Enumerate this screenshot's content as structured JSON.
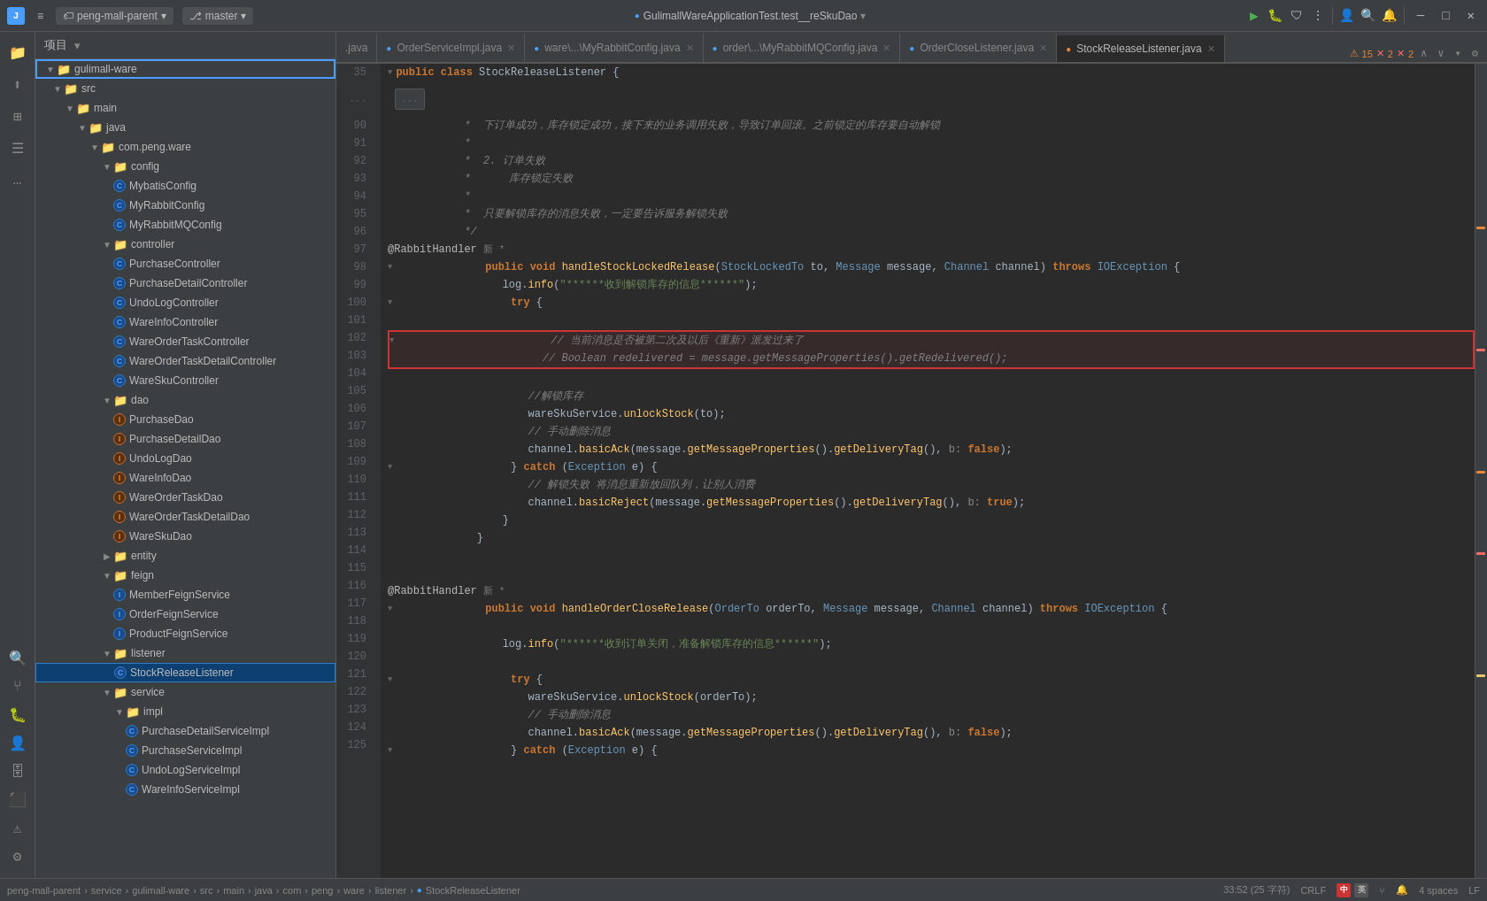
{
  "titlebar": {
    "logo": "J",
    "menu_items": [
      "peng-mall-parent",
      "master"
    ],
    "center_text": "GulimallWareApplicationTest.test__reSkuDao",
    "run_label": "▶",
    "settings_label": "⚙",
    "profile_label": "👤",
    "search_label": "🔍",
    "notifications_label": "🔔",
    "minimize": "─",
    "maximize": "□",
    "close": "✕"
  },
  "sidebar": {
    "header": "项目",
    "root": "gulimall-ware",
    "tree": [
      {
        "id": "src",
        "label": "src",
        "indent": 1,
        "type": "folder",
        "expanded": true
      },
      {
        "id": "main",
        "label": "main",
        "indent": 2,
        "type": "folder",
        "expanded": true
      },
      {
        "id": "java",
        "label": "java",
        "indent": 3,
        "type": "folder",
        "expanded": true
      },
      {
        "id": "com.peng.ware",
        "label": "com.peng.ware",
        "indent": 4,
        "type": "folder",
        "expanded": true
      },
      {
        "id": "config",
        "label": "config",
        "indent": 5,
        "type": "folder",
        "expanded": true
      },
      {
        "id": "MybatisConfig",
        "label": "MybatisConfig",
        "indent": 6,
        "type": "java-blue"
      },
      {
        "id": "MyRabbitConfig",
        "label": "MyRabbitConfig",
        "indent": 6,
        "type": "java-blue"
      },
      {
        "id": "MyRabbitMQConfig",
        "label": "MyRabbitMQConfig",
        "indent": 6,
        "type": "java-blue"
      },
      {
        "id": "controller",
        "label": "controller",
        "indent": 5,
        "type": "folder",
        "expanded": true
      },
      {
        "id": "PurchaseController",
        "label": "PurchaseController",
        "indent": 6,
        "type": "java-blue"
      },
      {
        "id": "PurchaseDetailController",
        "label": "PurchaseDetailController",
        "indent": 6,
        "type": "java-blue"
      },
      {
        "id": "UndoLogController",
        "label": "UndoLogController",
        "indent": 6,
        "type": "java-blue"
      },
      {
        "id": "WareInfoController",
        "label": "WareInfoController",
        "indent": 6,
        "type": "java-blue"
      },
      {
        "id": "WareOrderTaskController",
        "label": "WareOrderTaskController",
        "indent": 6,
        "type": "java-blue"
      },
      {
        "id": "WareOrderTaskDetailController",
        "label": "WareOrderTaskDetailController",
        "indent": 6,
        "type": "java-blue"
      },
      {
        "id": "WareSkuController",
        "label": "WareSkuController",
        "indent": 6,
        "type": "java-blue"
      },
      {
        "id": "dao",
        "label": "dao",
        "indent": 5,
        "type": "folder",
        "expanded": true
      },
      {
        "id": "PurchaseDao",
        "label": "PurchaseDao",
        "indent": 6,
        "type": "java-orange"
      },
      {
        "id": "PurchaseDetailDao",
        "label": "PurchaseDetailDao",
        "indent": 6,
        "type": "java-orange"
      },
      {
        "id": "UndoLogDao",
        "label": "UndoLogDao",
        "indent": 6,
        "type": "java-orange"
      },
      {
        "id": "WareInfoDao",
        "label": "WareInfoDao",
        "indent": 6,
        "type": "java-orange"
      },
      {
        "id": "WareOrderTaskDao",
        "label": "WareOrderTaskDao",
        "indent": 6,
        "type": "java-orange"
      },
      {
        "id": "WareOrderTaskDetailDao",
        "label": "WareOrderTaskDetailDao",
        "indent": 6,
        "type": "java-orange"
      },
      {
        "id": "WareSkuDao",
        "label": "WareSkuDao",
        "indent": 6,
        "type": "java-orange"
      },
      {
        "id": "entity",
        "label": "entity",
        "indent": 5,
        "type": "folder",
        "expanded": false
      },
      {
        "id": "feign",
        "label": "feign",
        "indent": 5,
        "type": "folder",
        "expanded": true
      },
      {
        "id": "MemberFeignService",
        "label": "MemberFeignService",
        "indent": 6,
        "type": "java-blue"
      },
      {
        "id": "OrderFeignService",
        "label": "OrderFeignService",
        "indent": 6,
        "type": "java-blue"
      },
      {
        "id": "ProductFeignService",
        "label": "ProductFeignService",
        "indent": 6,
        "type": "java-blue"
      },
      {
        "id": "listener",
        "label": "listener",
        "indent": 5,
        "type": "folder",
        "expanded": true
      },
      {
        "id": "StockReleaseListener",
        "label": "StockReleaseListener",
        "indent": 6,
        "type": "java-blue",
        "selected": true
      },
      {
        "id": "service",
        "label": "service",
        "indent": 5,
        "type": "folder",
        "expanded": true
      },
      {
        "id": "impl",
        "label": "impl",
        "indent": 6,
        "type": "folder",
        "expanded": true
      },
      {
        "id": "PurchaseDetailServiceImpl",
        "label": "PurchaseDetailServiceImpl",
        "indent": 7,
        "type": "java-blue"
      },
      {
        "id": "PurchaseServiceImpl",
        "label": "PurchaseServiceImpl",
        "indent": 7,
        "type": "java-blue"
      },
      {
        "id": "UndoLogServiceImpl",
        "label": "UndoLogServiceImpl",
        "indent": 7,
        "type": "java-blue"
      },
      {
        "id": "WareInfoServiceImpl",
        "label": "WareInfoServiceImpl",
        "indent": 7,
        "type": "java-blue"
      }
    ]
  },
  "tabs": [
    {
      "id": "java1",
      "label": ".java",
      "type": "plain",
      "closeable": false
    },
    {
      "id": "OrderServiceImpl",
      "label": "OrderServiceImpl.java",
      "type": "java-blue",
      "closeable": true
    },
    {
      "id": "MyRabbitConfig",
      "label": "ware\\...\\MyRabbitConfig.java",
      "type": "java-blue",
      "closeable": true
    },
    {
      "id": "MyRabbitMQConfig",
      "label": "order\\...\\MyRabbitMQConfig.java",
      "type": "java-blue",
      "closeable": true
    },
    {
      "id": "OrderCloseListener",
      "label": "OrderCloseListener.java",
      "type": "java-blue",
      "closeable": true
    },
    {
      "id": "StockReleaseListener",
      "label": "StockReleaseListener.java",
      "type": "java-blue",
      "closeable": true,
      "active": true
    }
  ],
  "editor": {
    "class_header": "public class StockReleaseListener {",
    "lines": [
      {
        "num": 35,
        "content": "    public class StockReleaseListener {",
        "type": "normal"
      },
      {
        "num": 90,
        "content": " *   下订单成功，库存锁定成功，接下来的业务调用失败，导致订单回滚。之前锁定的库存要自动解锁",
        "type": "comment"
      },
      {
        "num": 91,
        "content": " *",
        "type": "comment"
      },
      {
        "num": 92,
        "content": " *   2. 订单失败",
        "type": "comment"
      },
      {
        "num": 93,
        "content": " *      库存锁定失败",
        "type": "comment"
      },
      {
        "num": 94,
        "content": " *",
        "type": "comment"
      },
      {
        "num": 95,
        "content": " *   只要解锁库存的消息失败，一定要告诉服务解锁失败",
        "type": "comment"
      },
      {
        "num": 96,
        "content": " */",
        "type": "comment"
      },
      {
        "num": 97,
        "content": "@RabbitHandler 新 *",
        "type": "annotation"
      },
      {
        "num": 98,
        "content": "    public void handleStockLockedRelease(StockLockedTo to, Message message, Channel channel) throws IOException {",
        "type": "method"
      },
      {
        "num": 99,
        "content": "        log.info(\"******收到解锁库存的信息******\");",
        "type": "normal"
      },
      {
        "num": 100,
        "content": "        try {",
        "type": "normal"
      },
      {
        "num": 101,
        "content": "",
        "type": "normal"
      },
      {
        "num": 102,
        "content": "            // 当前消息是否被第二次及以后《重新》派发过来了",
        "type": "comment-highlighted"
      },
      {
        "num": 103,
        "content": "            // Boolean redelivered = message.getMessageProperties().getRedelivered();",
        "type": "comment-highlighted"
      },
      {
        "num": 104,
        "content": "",
        "type": "normal"
      },
      {
        "num": 105,
        "content": "            //解锁库存",
        "type": "comment"
      },
      {
        "num": 106,
        "content": "            wareSkuService.unlockStock(to);",
        "type": "normal"
      },
      {
        "num": 107,
        "content": "            // 手动删除消息",
        "type": "comment"
      },
      {
        "num": 108,
        "content": "            channel.basicAck(message.getMessageProperties().getDeliveryTag(), b: false);",
        "type": "normal"
      },
      {
        "num": 109,
        "content": "        } catch (Exception e) {",
        "type": "normal"
      },
      {
        "num": 110,
        "content": "            // 解锁失败 将消息重新放回队列，让别人消费",
        "type": "comment"
      },
      {
        "num": 111,
        "content": "            channel.basicReject(message.getMessageProperties().getDeliveryTag(), b: true);",
        "type": "normal"
      },
      {
        "num": 112,
        "content": "        }",
        "type": "normal"
      },
      {
        "num": 113,
        "content": "    }",
        "type": "normal"
      },
      {
        "num": 114,
        "content": "",
        "type": "normal"
      },
      {
        "num": 115,
        "content": "",
        "type": "normal"
      },
      {
        "num": 116,
        "content": "@RabbitHandler 新 *",
        "type": "annotation"
      },
      {
        "num": 117,
        "content": "    public void handleOrderCloseRelease(OrderTo orderTo, Message message, Channel channel) throws IOException {",
        "type": "method"
      },
      {
        "num": 118,
        "content": "",
        "type": "normal"
      },
      {
        "num": 119,
        "content": "        log.info(\"******收到订单关闭，准备解锁库存的信息******\");",
        "type": "normal"
      },
      {
        "num": 120,
        "content": "",
        "type": "normal"
      },
      {
        "num": 121,
        "content": "        try {",
        "type": "normal"
      },
      {
        "num": 122,
        "content": "            wareSkuService.unlockStock(orderTo);",
        "type": "normal"
      },
      {
        "num": 123,
        "content": "            // 手动删除消息",
        "type": "comment"
      },
      {
        "num": 124,
        "content": "            channel.basicAck(message.getMessageProperties().getDeliveryTag(), b: false);",
        "type": "normal"
      },
      {
        "num": 125,
        "content": "        } catch (Exception e) {",
        "type": "normal"
      }
    ],
    "warnings": {
      "warn": 15,
      "err1": 2,
      "err2": 2
    }
  },
  "statusbar": {
    "breadcrumb": [
      "peng-mall-parent",
      "service",
      "gulimall-ware",
      "src",
      "main",
      "java",
      "com",
      "peng",
      "ware",
      "listener",
      "StockReleaseListener"
    ],
    "position": "33:52 (25 字符)",
    "encoding": "CRLF",
    "lang_zh": "中",
    "lang_en": "英"
  }
}
